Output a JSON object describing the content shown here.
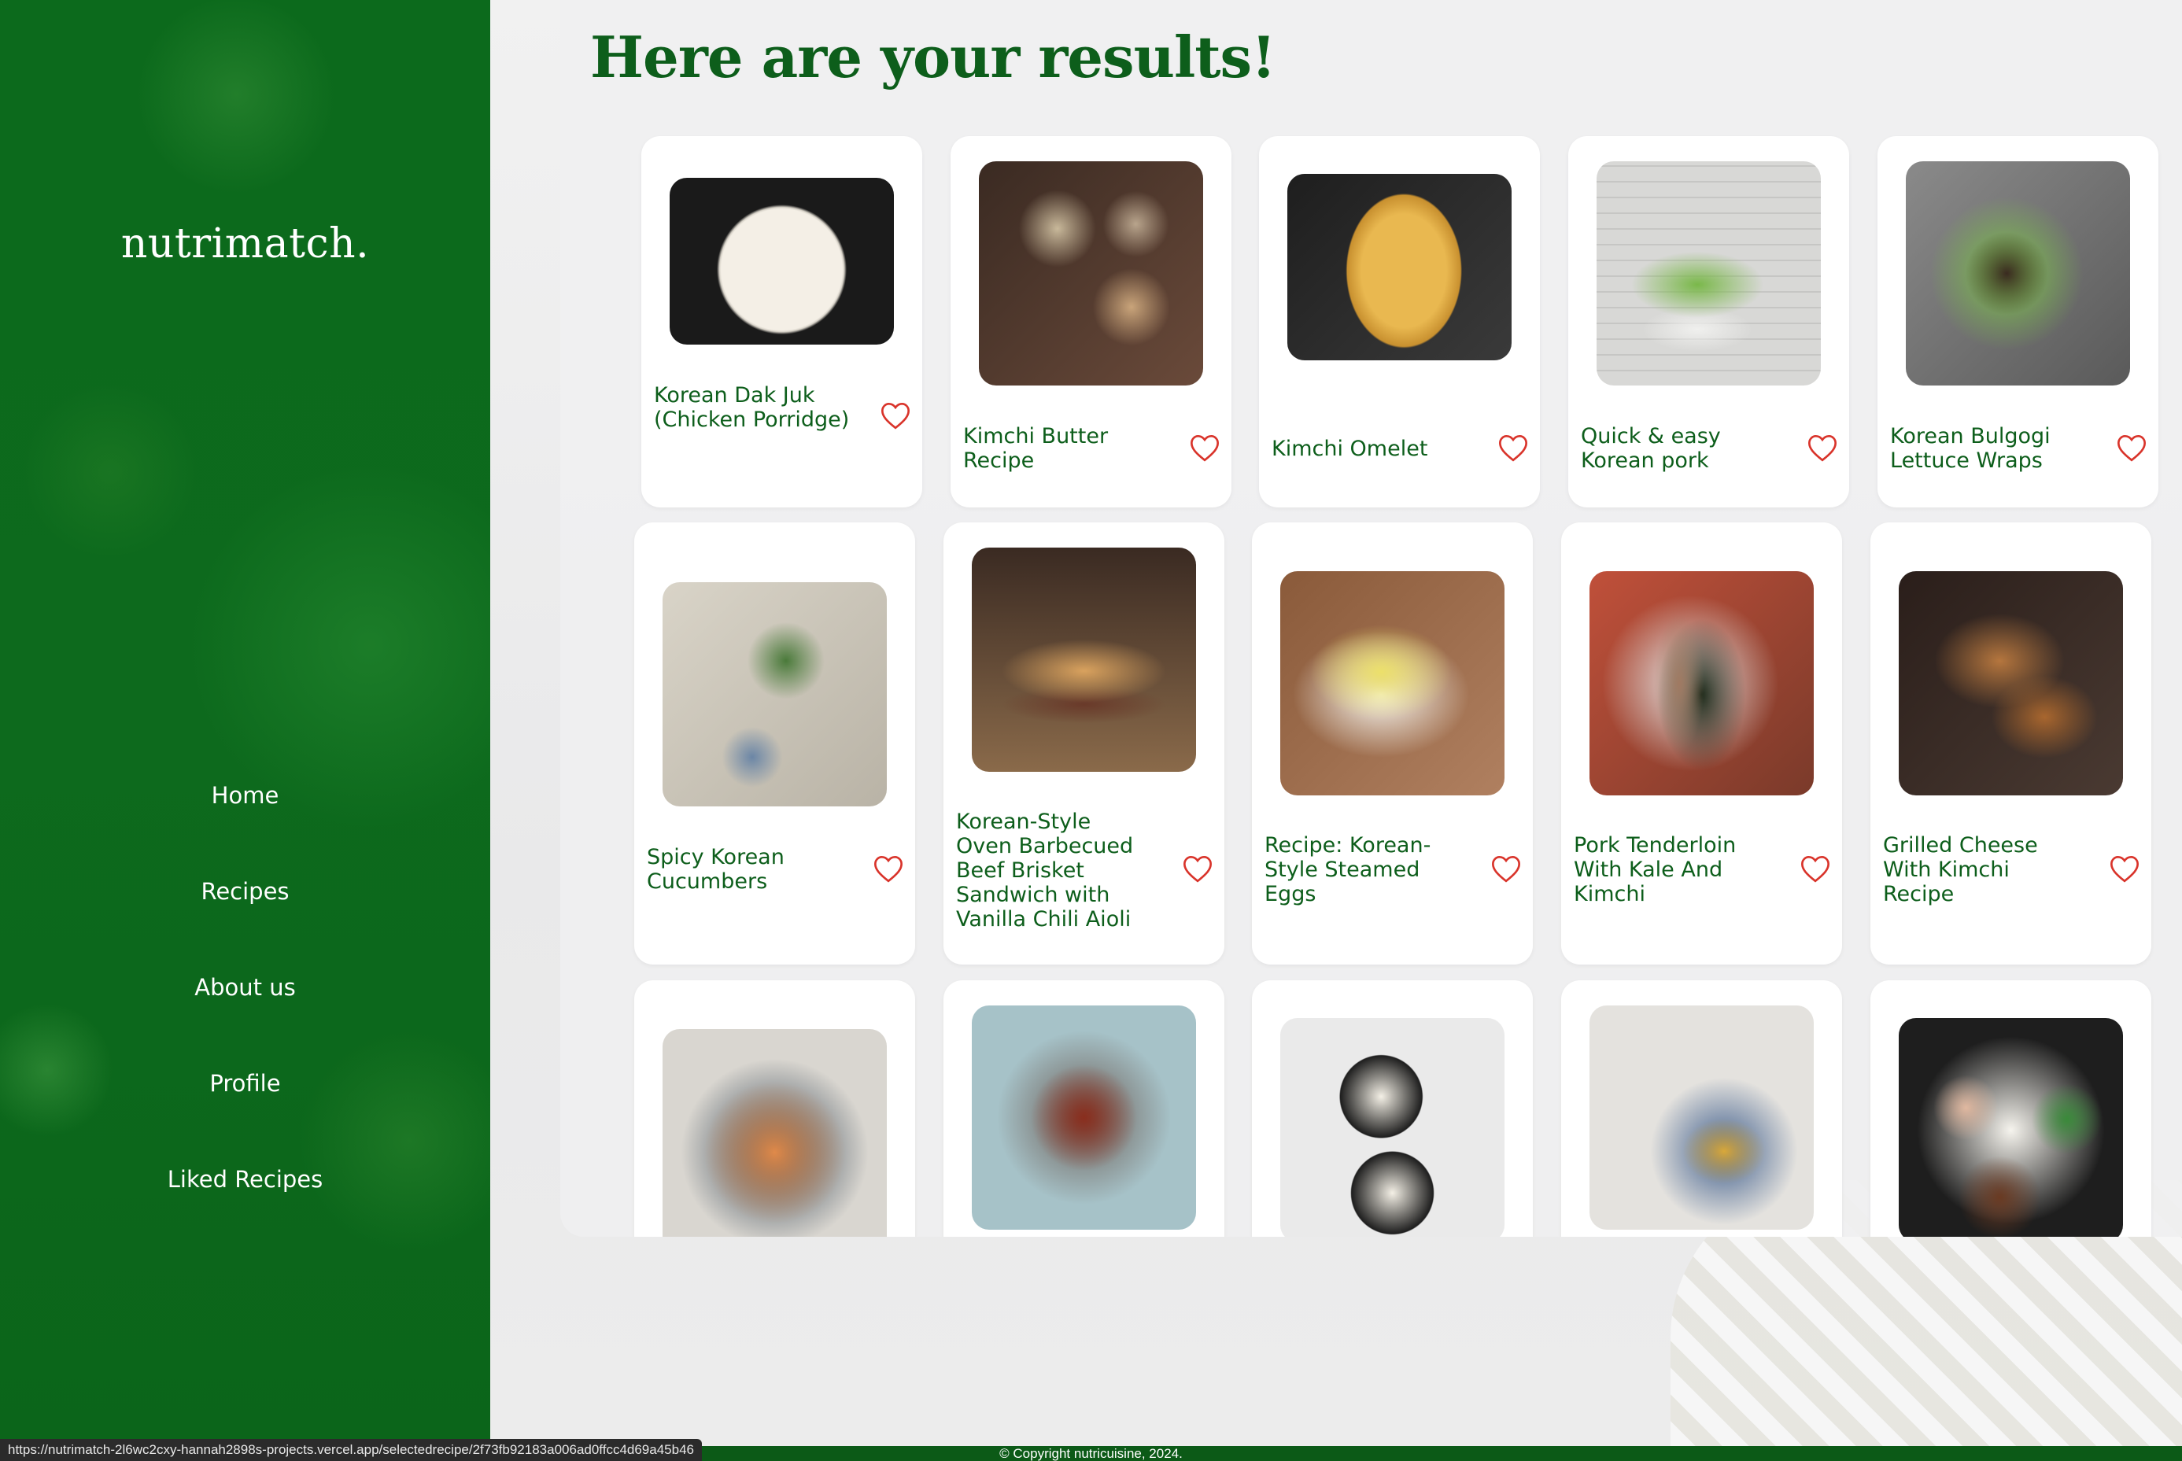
{
  "brand": {
    "name": "nutrimatch."
  },
  "nav": {
    "items": [
      "Home",
      "Recipes",
      "About us",
      "Profile",
      "Liked Recipes"
    ]
  },
  "main": {
    "title": "Here are your results!"
  },
  "recipes": [
    {
      "title": "Korean Dak Juk (Chicken Porridge)"
    },
    {
      "title": "Kimchi Butter Recipe"
    },
    {
      "title": "Kimchi Omelet"
    },
    {
      "title": "Quick & easy Korean pork"
    },
    {
      "title": "Korean Bulgogi Lettuce Wraps"
    },
    {
      "title": "Spicy Korean Cucumbers"
    },
    {
      "title": "Korean-Style Oven Barbecued Beef Brisket Sandwich with Vanilla Chili Aioli"
    },
    {
      "title": "Recipe: Korean-Style Steamed Eggs"
    },
    {
      "title": "Pork Tenderloin With Kale And Kimchi"
    },
    {
      "title": "Grilled Cheese With Kimchi Recipe"
    }
  ],
  "footer": {
    "copyright": "© Copyright nutricuisine, 2024."
  },
  "status_bar": {
    "url": "https://nutrimatch-2l6wc2cxy-hannah2898s-projects.vercel.app/selectedrecipe/2f73fb92183a006ad0ffcc4d69a45b46"
  },
  "colors": {
    "brand_green": "#0d6a1d",
    "title_green": "#0d5e1b",
    "heart_red": "#d9342b"
  }
}
